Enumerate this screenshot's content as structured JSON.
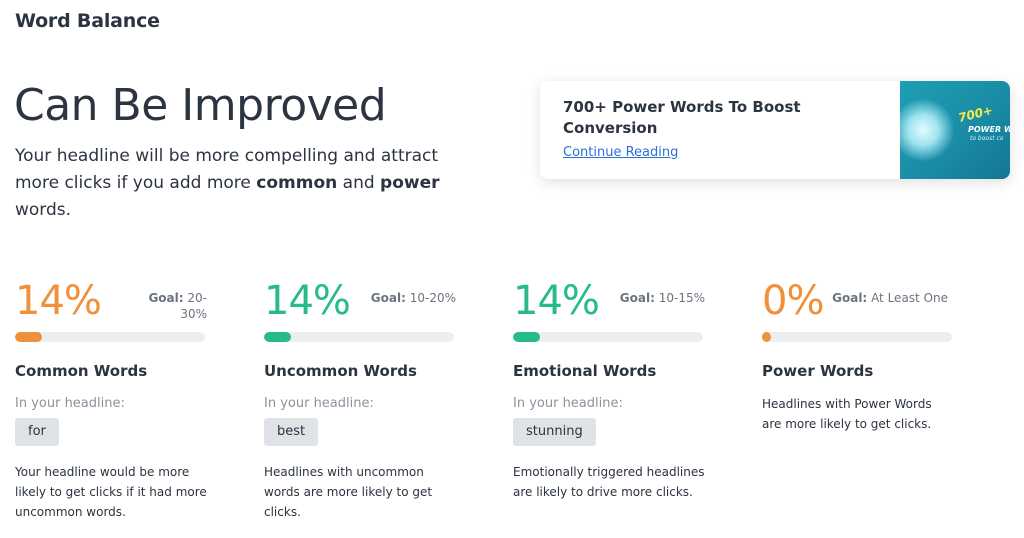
{
  "section_title": "Word Balance",
  "verdict": "Can Be Improved",
  "summary": {
    "part1": "Your headline will be more compelling and attract more clicks if you add more ",
    "bold1": "common",
    "part2": " and ",
    "bold2": "power",
    "part3": " words."
  },
  "article": {
    "title": "700+ Power Words To Boost Conversion",
    "link": "Continue Reading",
    "thumb_number": "700+",
    "thumb_label": "POWER W",
    "thumb_sub": "to boost co"
  },
  "colors": {
    "orange": "#f0903a",
    "green": "#27bb86",
    "text": "#2b3440"
  },
  "metrics": [
    {
      "percent_label": "14%",
      "percent": 14,
      "goal_label": "Goal:",
      "goal_line1": "20-",
      "goal_line2": "30%",
      "name": "Common Words",
      "sub": "In your headline:",
      "chip": "for",
      "desc": "Your headline would be more likely to get clicks if it had more uncommon words."
    },
    {
      "percent_label": "14%",
      "percent": 14,
      "goal_label": "Goal:",
      "goal_line1": "10-20%",
      "name": "Uncommon Words",
      "sub": "In your headline:",
      "chip": "best",
      "desc": "Headlines with uncommon words are more likely to get clicks."
    },
    {
      "percent_label": "14%",
      "percent": 14,
      "goal_label": "Goal:",
      "goal_line1": "10-15%",
      "name": "Emotional Words",
      "sub": "In your headline:",
      "chip": "stunning",
      "desc": "Emotionally triggered headlines are likely to drive more clicks."
    },
    {
      "percent_label": "0%",
      "percent": 0,
      "goal_label": "Goal:",
      "goal_line1": "At Least One",
      "name": "Power Words",
      "desc": "Headlines with Power Words are more likely to get clicks."
    }
  ]
}
